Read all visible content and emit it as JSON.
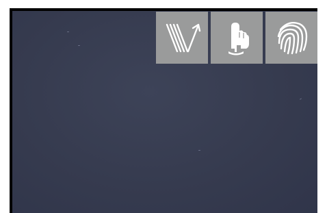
{
  "toolbar": {
    "buttons": [
      {
        "name": "rotate-lines-tool",
        "icon": "diagonal-lines-arrow-icon"
      },
      {
        "name": "touch-tool",
        "icon": "finger-press-icon"
      },
      {
        "name": "fingerprint-tool",
        "icon": "fingerprint-icon"
      }
    ]
  },
  "colors": {
    "screen_background": "#363b4f",
    "button_background": "#9a9b9b",
    "icon_color": "#ffffff",
    "frame": "#000000"
  }
}
